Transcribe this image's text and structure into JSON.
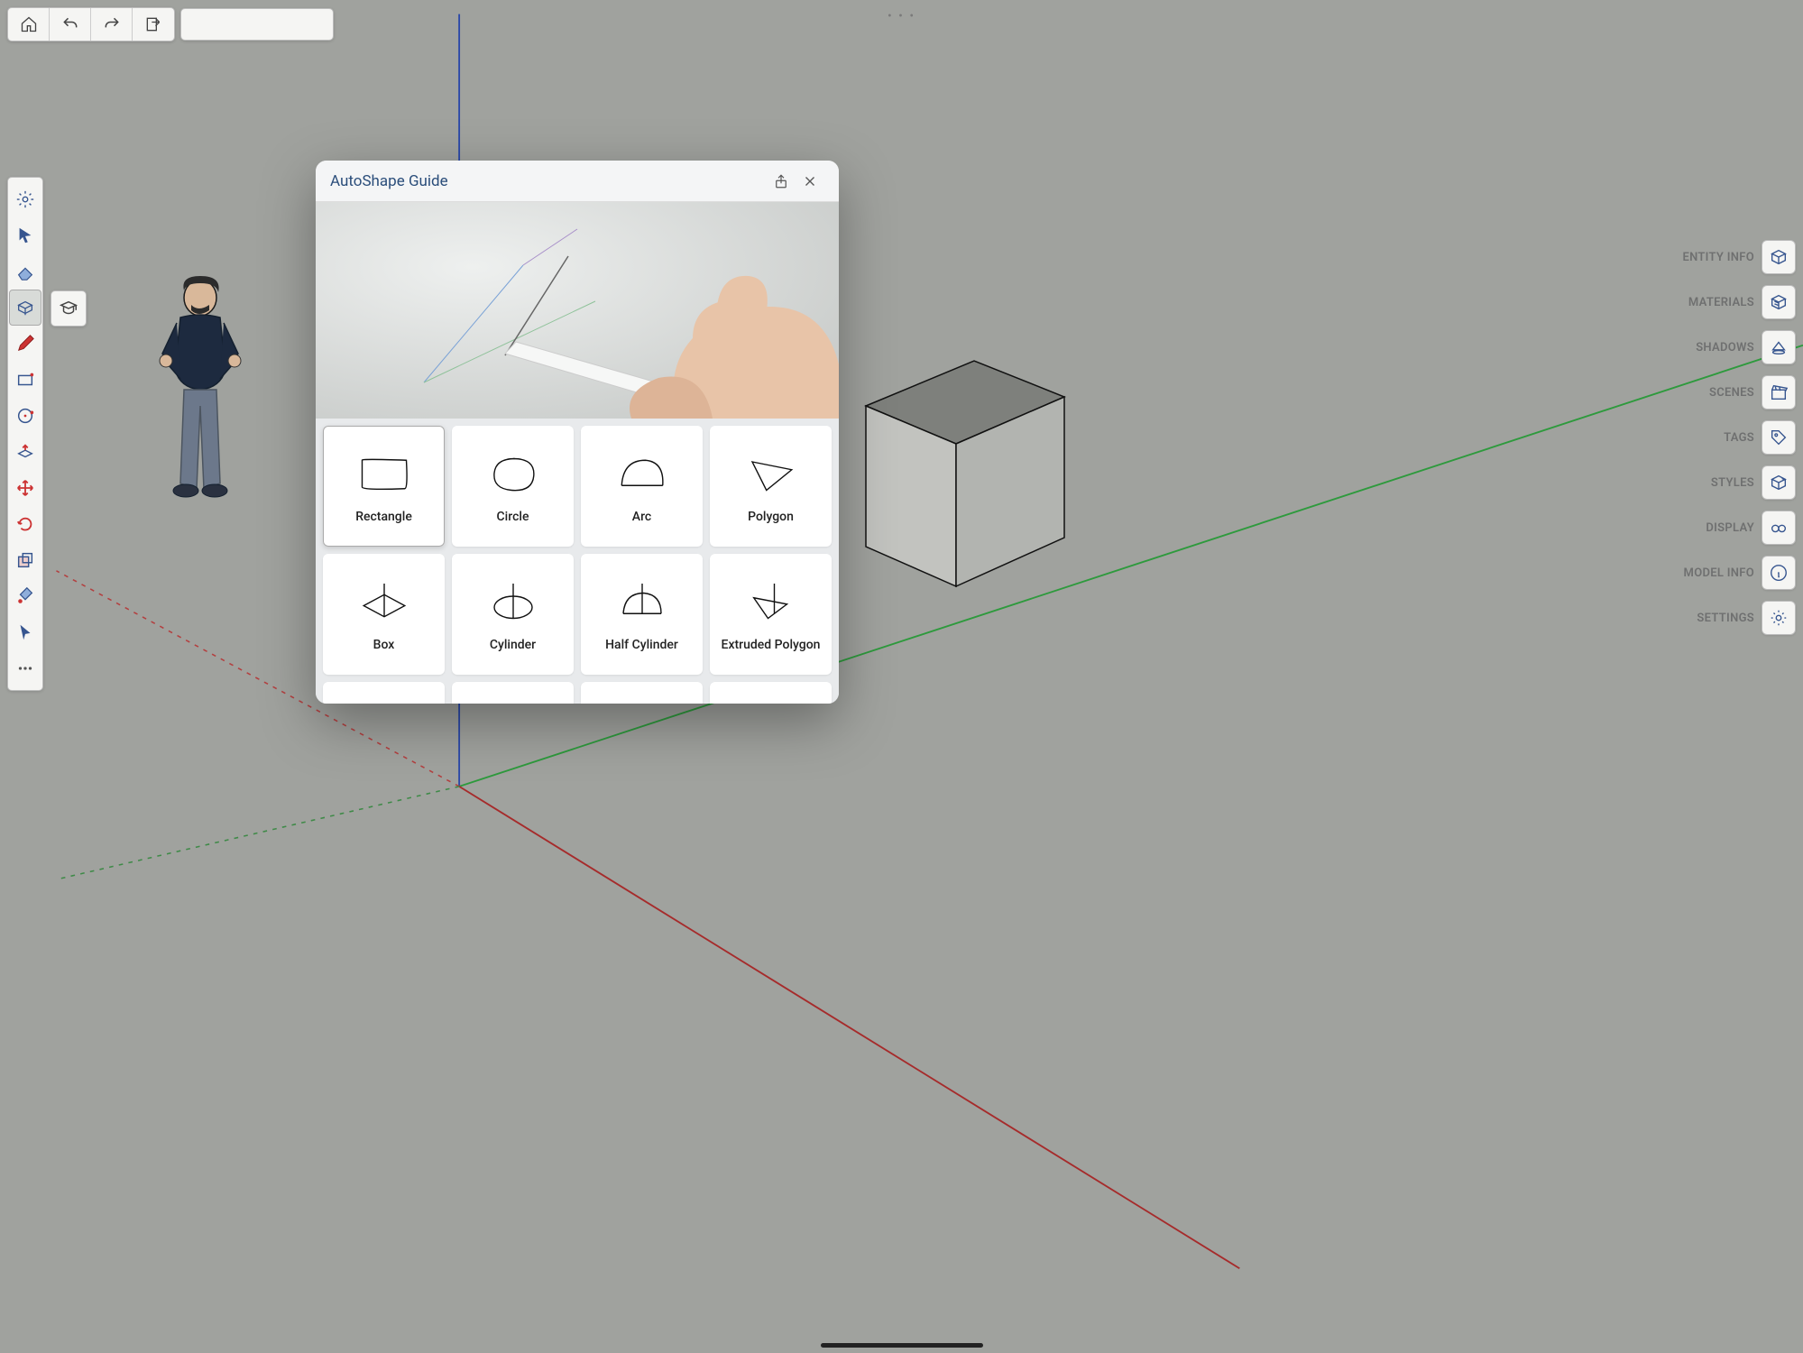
{
  "modal": {
    "title": "AutoShape Guide",
    "shapes": [
      {
        "label": "Rectangle"
      },
      {
        "label": "Circle"
      },
      {
        "label": "Arc"
      },
      {
        "label": "Polygon"
      },
      {
        "label": "Box"
      },
      {
        "label": "Cylinder"
      },
      {
        "label": "Half Cylinder"
      },
      {
        "label": "Extruded Polygon"
      }
    ]
  },
  "right_panels": [
    {
      "label": "ENTITY INFO",
      "icon": "cube-info"
    },
    {
      "label": "MATERIALS",
      "icon": "cube-textured"
    },
    {
      "label": "SHADOWS",
      "icon": "eraser"
    },
    {
      "label": "SCENES",
      "icon": "clapboard"
    },
    {
      "label": "TAGS",
      "icon": "tag"
    },
    {
      "label": "STYLES",
      "icon": "cube-style"
    },
    {
      "label": "DISPLAY",
      "icon": "glasses"
    },
    {
      "label": "MODEL INFO",
      "icon": "info"
    },
    {
      "label": "SETTINGS",
      "icon": "gear"
    }
  ],
  "left_tools": [
    {
      "name": "settings-gear",
      "color": "#36558f"
    },
    {
      "name": "select-arrow",
      "color": "#36558f"
    },
    {
      "name": "eraser",
      "color": "#36558f"
    },
    {
      "name": "autoshape-cube",
      "color": "#36558f",
      "active": true
    },
    {
      "name": "pencil",
      "color": "#c33"
    },
    {
      "name": "rectangle",
      "color": "#36558f"
    },
    {
      "name": "circle",
      "color": "#36558f"
    },
    {
      "name": "push-pull",
      "color": "#c33"
    },
    {
      "name": "move",
      "color": "#c33"
    },
    {
      "name": "rotate",
      "color": "#c33"
    },
    {
      "name": "scale",
      "color": "#36558f"
    },
    {
      "name": "paint-bucket",
      "color": "#36558f"
    },
    {
      "name": "pointer",
      "color": "#36558f"
    },
    {
      "name": "more-dots",
      "color": "#555"
    }
  ],
  "top_buttons": [
    {
      "name": "home"
    },
    {
      "name": "undo"
    },
    {
      "name": "redo"
    },
    {
      "name": "export"
    }
  ],
  "flyout": {
    "name": "learn"
  }
}
